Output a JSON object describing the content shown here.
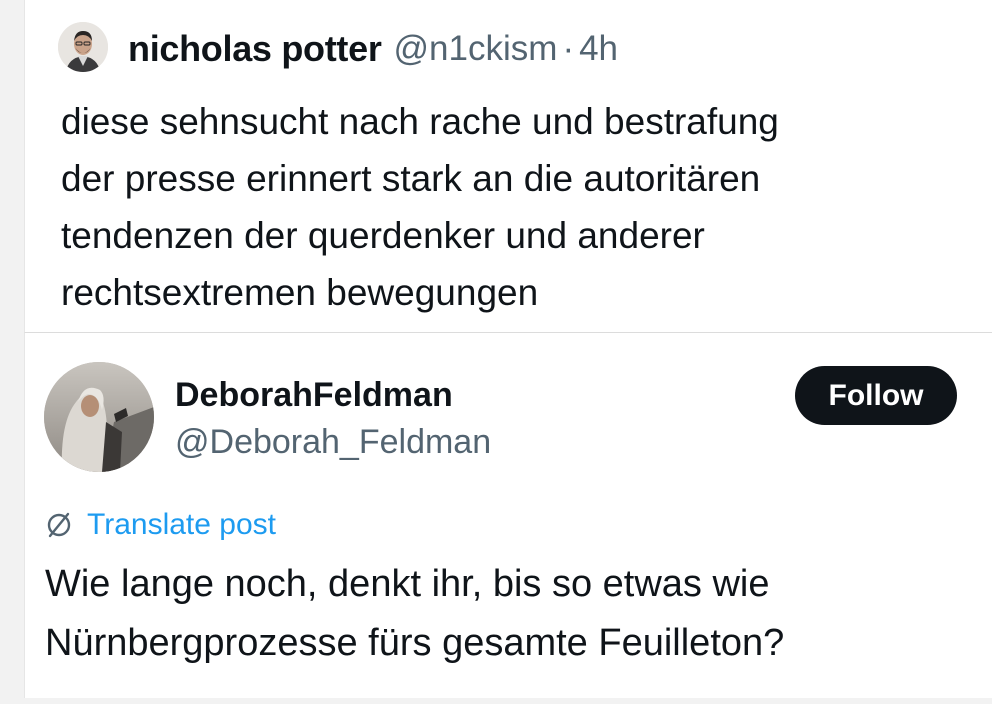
{
  "quoted_post": {
    "author_name": "nicholas potter",
    "author_handle": "@n1ckism",
    "separator": "·",
    "time": "4h",
    "text_lines": [
      "diese sehnsucht nach rache und bestrafung",
      "der presse erinnert stark an die autoritären",
      "tendenzen der querdenker und anderer",
      "rechtsextremen bewegungen"
    ]
  },
  "main_post": {
    "author_name": "DeborahFeldman",
    "author_handle": "@Deborah_Feldman",
    "follow_label": "Follow",
    "translate_label": "Translate post",
    "translate_icon": "globe-slash-icon",
    "text_lines": [
      "Wie lange noch, denkt ihr, bis so etwas wie",
      "Nürnbergprozesse fürs gesamte Feuilleton?"
    ]
  },
  "colors": {
    "text": "#0f1419",
    "secondary": "#536471",
    "link": "#1d9bf0",
    "button": "#0f1419"
  }
}
